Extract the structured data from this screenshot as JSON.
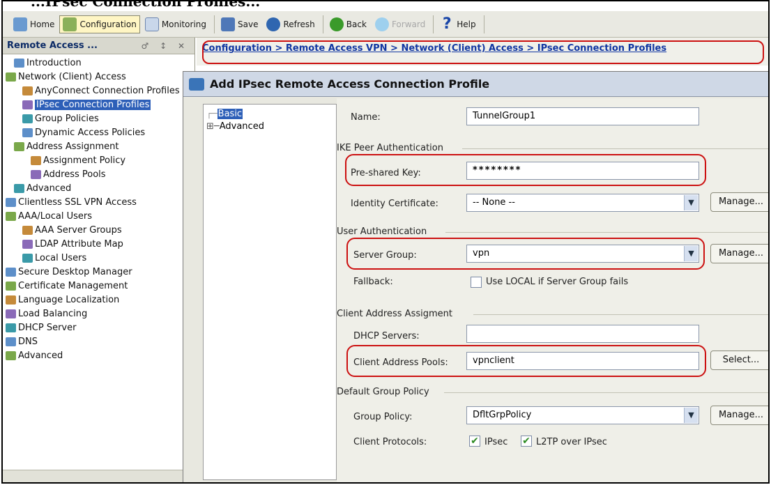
{
  "caption": "...IPsec Connection Profiles...",
  "toolbar": {
    "items": [
      {
        "label": "Home",
        "icon": "home-icon",
        "active": false,
        "disabled": false
      },
      {
        "label": "Configuration",
        "icon": "configuration-icon",
        "active": true,
        "disabled": false
      },
      {
        "label": "Monitoring",
        "icon": "monitoring-icon",
        "active": false,
        "disabled": false
      },
      {
        "label": "Save",
        "icon": "save-icon",
        "active": false,
        "disabled": false
      },
      {
        "label": "Refresh",
        "icon": "refresh-icon",
        "active": false,
        "disabled": false
      },
      {
        "label": "Back",
        "icon": "back-icon",
        "active": false,
        "disabled": false
      },
      {
        "label": "Forward",
        "icon": "forward-icon",
        "active": false,
        "disabled": true
      },
      {
        "label": "Help",
        "icon": "help-icon",
        "active": false,
        "disabled": false
      }
    ]
  },
  "left_panel": {
    "title": "Remote Access ...",
    "controls": "♂ ↕ ✕",
    "tree": [
      {
        "label": "Introduction",
        "level": 1,
        "icon": "help-icon"
      },
      {
        "label": "Network (Client) Access",
        "level": 0,
        "icon": "network-icon"
      },
      {
        "label": "AnyConnect Connection Profiles",
        "level": 2,
        "icon": "connection-icon"
      },
      {
        "label": "IPsec Connection Profiles",
        "level": 2,
        "icon": "connection-icon",
        "selected": true
      },
      {
        "label": "Group Policies",
        "level": 2,
        "icon": "group-policy-icon"
      },
      {
        "label": "Dynamic Access Policies",
        "level": 2,
        "icon": "dap-icon"
      },
      {
        "label": "Address Assignment",
        "level": 1,
        "icon": "address-icon"
      },
      {
        "label": "Assignment Policy",
        "level": 3,
        "icon": "policy-icon"
      },
      {
        "label": "Address Pools",
        "level": 3,
        "icon": "ip-icon"
      },
      {
        "label": "Advanced",
        "level": 1,
        "icon": "advanced-icon"
      },
      {
        "label": "Clientless SSL VPN Access",
        "level": 0,
        "icon": "ssl-icon"
      },
      {
        "label": "AAA/Local Users",
        "level": 0,
        "icon": "users-icon"
      },
      {
        "label": "AAA Server Groups",
        "level": 2,
        "icon": "server-icon"
      },
      {
        "label": "LDAP Attribute Map",
        "level": 2,
        "icon": "ldap-icon"
      },
      {
        "label": "Local Users",
        "level": 2,
        "icon": "local-users-icon"
      },
      {
        "label": "Secure Desktop Manager",
        "level": 0,
        "icon": "desktop-icon"
      },
      {
        "label": "Certificate Management",
        "level": 0,
        "icon": "certificate-icon"
      },
      {
        "label": "Language Localization",
        "level": 0,
        "icon": "language-icon"
      },
      {
        "label": "Load Balancing",
        "level": 0,
        "icon": "load-balancing-icon"
      },
      {
        "label": "DHCP Server",
        "level": 0,
        "icon": "dhcp-icon"
      },
      {
        "label": "DNS",
        "level": 0,
        "icon": "dns-icon"
      },
      {
        "label": "Advanced",
        "level": 0,
        "icon": "advanced-icon"
      }
    ]
  },
  "breadcrumb": "Configuration > Remote Access VPN > Network (Client) Access > IPsec Connection Profiles",
  "dialog": {
    "title": "Add IPsec Remote Access Connection Profile",
    "tree": [
      {
        "label": "Basic",
        "selected": true
      },
      {
        "label": "Advanced",
        "selected": false
      }
    ],
    "name_label": "Name:",
    "name_value": "TunnelGroup1",
    "ike_section": "IKE Peer Authentication",
    "psk_label": "Pre-shared Key:",
    "psk_value": "********",
    "id_cert_label": "Identity Certificate:",
    "id_cert_value": "-- None --",
    "manage_label": "Manage...",
    "user_auth_section": "User Authentication",
    "server_group_label": "Server Group:",
    "server_group_value": "vpn",
    "fallback_label": "Fallback:",
    "fallback_checkbox_label": "Use LOCAL if Server Group fails",
    "client_addr_section": "Client Address Assigment",
    "dhcp_label": "DHCP Servers:",
    "dhcp_value": "",
    "pools_label": "Client Address Pools:",
    "pools_value": "vpnclient",
    "select_label": "Select...",
    "default_policy_section": "Default Group Policy",
    "group_policy_label": "Group Policy:",
    "group_policy_value": "DfltGrpPolicy",
    "client_protocols_label": "Client Protocols:",
    "protocol_ipsec": "IPsec",
    "protocol_l2tp": "L2TP over IPsec"
  },
  "colors": {
    "highlight": "#cc1010",
    "selection": "#2d5fb8",
    "link": "#1036a2"
  }
}
